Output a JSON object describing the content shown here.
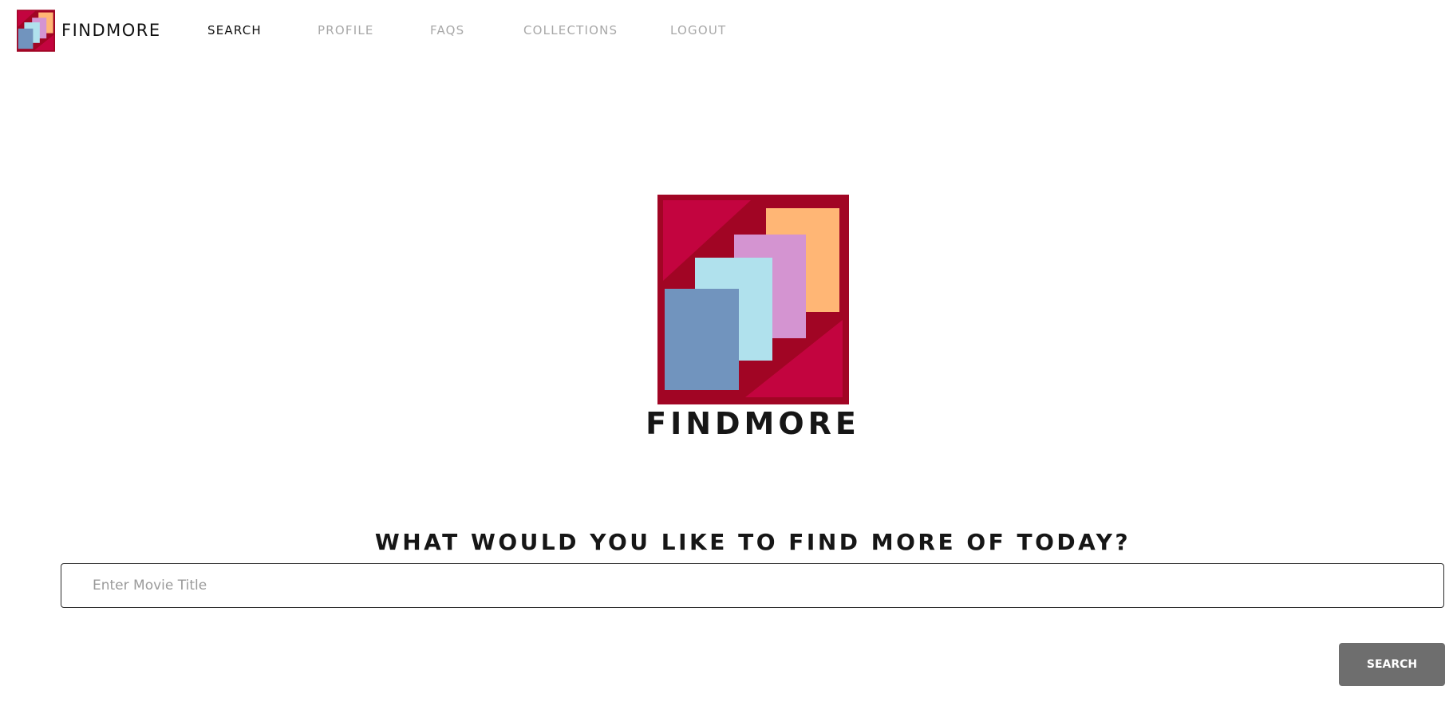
{
  "brand": {
    "name": "FINDMORE",
    "logo_icon": "findmore-logo-icon"
  },
  "nav": {
    "items": [
      {
        "label": "SEARCH",
        "active": true
      },
      {
        "label": "PROFILE",
        "active": false
      },
      {
        "label": "FAQS",
        "active": false
      },
      {
        "label": "COLLECTIONS",
        "active": false
      },
      {
        "label": "LOGOUT",
        "active": false
      }
    ]
  },
  "hero": {
    "title": "FINDMORE"
  },
  "search": {
    "prompt": "WHAT WOULD YOU LIKE TO FIND MORE OF TODAY?",
    "placeholder": "Enter Movie Title",
    "button_label": "SEARCH"
  },
  "colors": {
    "logo_background": "#a10524",
    "logo_triangles": "#c3043f",
    "card_orange": "#ffb675",
    "card_pink": "#d494d1",
    "card_light_blue": "#b0e1ed",
    "card_blue": "#7194be",
    "button_background": "#6e6e6e",
    "nav_inactive": "#a8a8a8"
  }
}
